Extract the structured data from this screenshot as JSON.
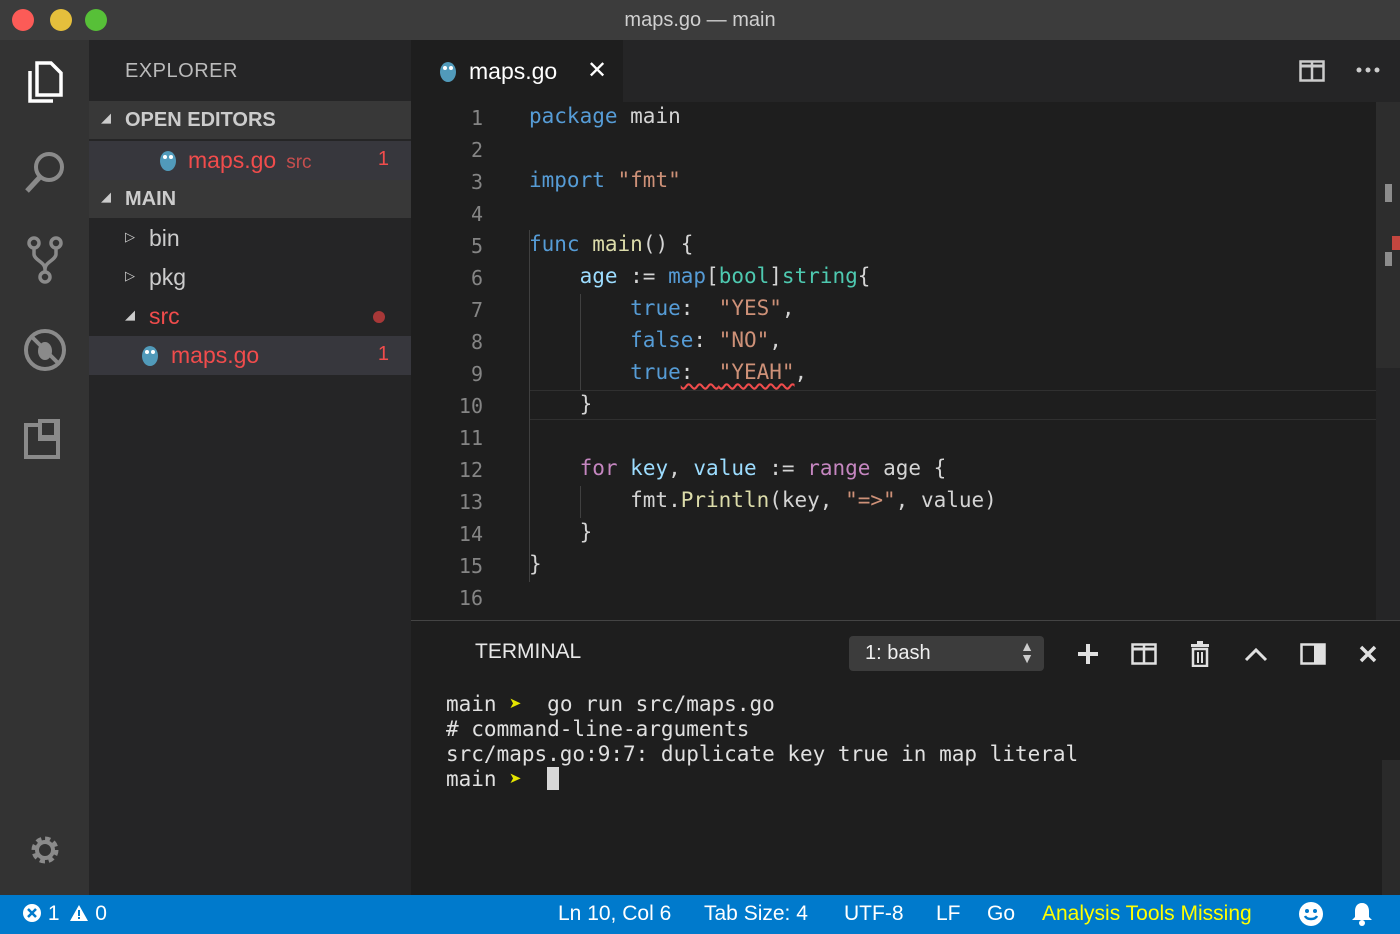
{
  "window": {
    "title": "maps.go — main"
  },
  "activity_bar": {
    "icons": [
      "files-icon",
      "search-icon",
      "source-control-icon",
      "debug-icon",
      "extensions-icon",
      "settings-gear-icon"
    ]
  },
  "sidebar": {
    "title": "EXPLORER",
    "open_editors": {
      "header": "OPEN EDITORS",
      "items": [
        {
          "name": "maps.go",
          "path": "src",
          "problems": "1"
        }
      ]
    },
    "folder": {
      "header": "MAIN",
      "items": [
        {
          "name": "bin"
        },
        {
          "name": "pkg"
        },
        {
          "name": "src"
        },
        {
          "name": "maps.go",
          "problems": "1"
        }
      ]
    }
  },
  "editor": {
    "tab": {
      "label": "maps.go",
      "close": "✕"
    },
    "line_numbers": [
      "1",
      "2",
      "3",
      "4",
      "5",
      "6",
      "7",
      "8",
      "9",
      "10",
      "11",
      "12",
      "13",
      "14",
      "15",
      "16"
    ],
    "lines": [
      [
        {
          "t": "package",
          "c": "kw"
        },
        {
          "t": " main",
          "c": ""
        }
      ],
      [],
      [
        {
          "t": "import",
          "c": "kw"
        },
        {
          "t": " ",
          "c": ""
        },
        {
          "t": "\"fmt\"",
          "c": "str"
        }
      ],
      [],
      [
        {
          "t": "func",
          "c": "kw"
        },
        {
          "t": " ",
          "c": ""
        },
        {
          "t": "main",
          "c": "fn"
        },
        {
          "t": "() {",
          "c": ""
        }
      ],
      [
        {
          "t": "    ",
          "c": ""
        },
        {
          "t": "age",
          "c": "var"
        },
        {
          "t": " := ",
          "c": ""
        },
        {
          "t": "map",
          "c": "kw"
        },
        {
          "t": "[",
          "c": ""
        },
        {
          "t": "bool",
          "c": "ty"
        },
        {
          "t": "]",
          "c": ""
        },
        {
          "t": "string",
          "c": "ty"
        },
        {
          "t": "{",
          "c": ""
        }
      ],
      [
        {
          "t": "        ",
          "c": ""
        },
        {
          "t": "true",
          "c": "kw"
        },
        {
          "t": ":  ",
          "c": ""
        },
        {
          "t": "\"YES\"",
          "c": "str"
        },
        {
          "t": ",",
          "c": ""
        }
      ],
      [
        {
          "t": "        ",
          "c": ""
        },
        {
          "t": "false",
          "c": "kw"
        },
        {
          "t": ": ",
          "c": ""
        },
        {
          "t": "\"NO\"",
          "c": "str"
        },
        {
          "t": ",",
          "c": ""
        }
      ],
      [
        {
          "t": "        ",
          "c": ""
        },
        {
          "t": "true",
          "c": "kw"
        },
        {
          "t": ":  ",
          "c": "squiggle"
        },
        {
          "t": "\"YEAH\"",
          "c": "str squiggle"
        },
        {
          "t": ",",
          "c": ""
        }
      ],
      [
        {
          "t": "    }",
          "c": ""
        }
      ],
      [],
      [
        {
          "t": "    ",
          "c": ""
        },
        {
          "t": "for",
          "c": "ctl"
        },
        {
          "t": " ",
          "c": ""
        },
        {
          "t": "key",
          "c": "var"
        },
        {
          "t": ", ",
          "c": ""
        },
        {
          "t": "value",
          "c": "var"
        },
        {
          "t": " := ",
          "c": ""
        },
        {
          "t": "range",
          "c": "ctl"
        },
        {
          "t": " age {",
          "c": ""
        }
      ],
      [
        {
          "t": "        fmt.",
          "c": ""
        },
        {
          "t": "Println",
          "c": "fn"
        },
        {
          "t": "(key, ",
          "c": ""
        },
        {
          "t": "\"=>\"",
          "c": "str"
        },
        {
          "t": ", value)",
          "c": ""
        }
      ],
      [
        {
          "t": "    }",
          "c": ""
        }
      ],
      [
        {
          "t": "}",
          "c": ""
        }
      ],
      []
    ]
  },
  "panel": {
    "title": "TERMINAL",
    "shell_select": "1: bash",
    "buttons": [
      "add-terminal",
      "split-terminal",
      "kill-terminal",
      "maximize-panel",
      "toggle-panel",
      "close-panel"
    ],
    "output": [
      {
        "prompt": "main",
        "arrow": "➤",
        "text": "  go run src/maps.go"
      },
      {
        "text": "# command-line-arguments"
      },
      {
        "text": "src/maps.go:9:7: duplicate key true in map literal"
      },
      {
        "prompt": "main",
        "arrow": "➤",
        "text": "  ",
        "cursor": true
      }
    ]
  },
  "status_bar": {
    "errors": "1",
    "warnings": "0",
    "position": "Ln 10, Col 6",
    "tab_size": "Tab Size: 4",
    "encoding": "UTF-8",
    "eol": "LF",
    "language": "Go",
    "warning_text": "Analysis Tools Missing"
  },
  "colors": {
    "accent": "#007acc",
    "error": "#f14c4c",
    "warning_text": "#ffff00"
  }
}
